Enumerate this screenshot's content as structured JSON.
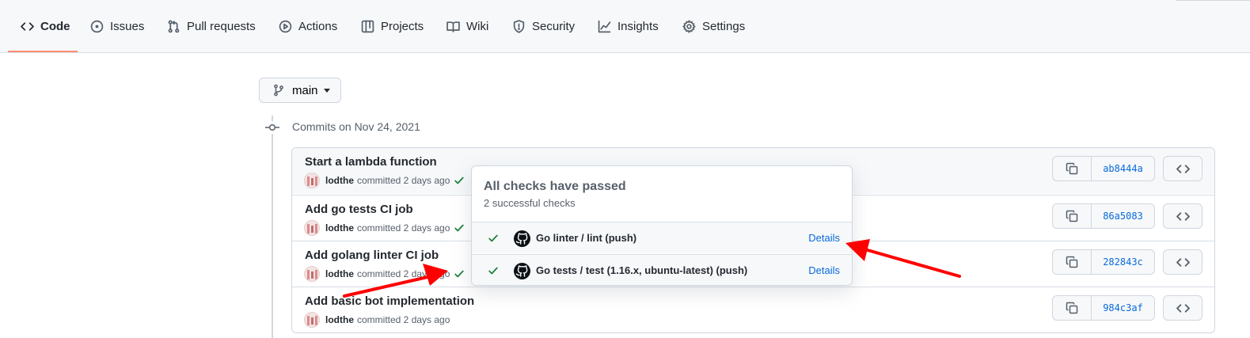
{
  "nav": {
    "tabs": [
      {
        "label": "Code",
        "icon": "code-icon",
        "active": true
      },
      {
        "label": "Issues",
        "icon": "issue-opened-icon"
      },
      {
        "label": "Pull requests",
        "icon": "git-pull-request-icon"
      },
      {
        "label": "Actions",
        "icon": "play-icon"
      },
      {
        "label": "Projects",
        "icon": "table-icon"
      },
      {
        "label": "Wiki",
        "icon": "book-icon"
      },
      {
        "label": "Security",
        "icon": "shield-icon"
      },
      {
        "label": "Insights",
        "icon": "graph-icon"
      },
      {
        "label": "Settings",
        "icon": "gear-icon"
      }
    ],
    "active_underline_color": "#fd8c73"
  },
  "branch": {
    "name": "main",
    "icon": "git-branch-icon"
  },
  "timeline": {
    "date_heading": "Commits on Nov 24, 2021"
  },
  "commits": [
    {
      "title": "Start a lambda function",
      "author": "lodthe",
      "meta": "committed 2 days ago",
      "status": "success",
      "sha": "ab8444a"
    },
    {
      "title": "Add go tests CI job",
      "author": "lodthe",
      "meta": "committed 2 days ago",
      "status": "success",
      "sha": "86a5083"
    },
    {
      "title": "Add golang linter CI job",
      "author": "lodthe",
      "meta": "committed 2 days ago",
      "status": "success",
      "sha": "282843c"
    },
    {
      "title": "Add basic bot implementation",
      "author": "lodthe",
      "meta": "committed 2 days ago",
      "status": "none",
      "sha": "984c3af"
    }
  ],
  "checks_popover": {
    "title": "All checks have passed",
    "subtitle": "2 successful checks",
    "checks": [
      {
        "name": "Go linter / lint (push)",
        "link": "Details",
        "status": "success"
      },
      {
        "name": "Go tests / test (1.16.x, ubuntu-latest) (push)",
        "link": "Details",
        "status": "success"
      }
    ]
  },
  "colors": {
    "success": "#1a7f37",
    "link": "#0969da",
    "annotation_arrow": "#ff0000"
  }
}
